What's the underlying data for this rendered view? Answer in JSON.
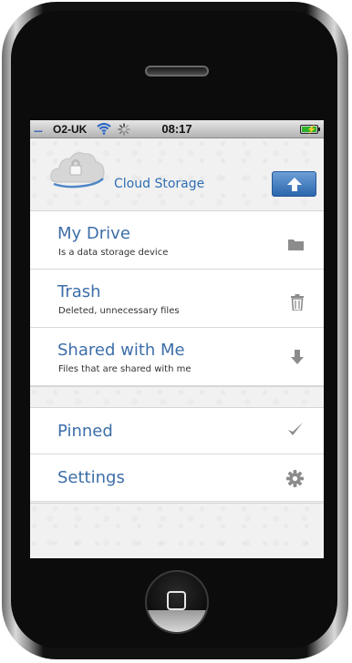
{
  "status_bar": {
    "carrier": "O2-UK",
    "time": "08:17",
    "signal_icon": "signal-bars-icon",
    "wifi_icon": "wifi-icon",
    "activity_icon": "activity-spinner-icon",
    "battery_icon": "battery-charging-icon"
  },
  "header": {
    "app_title": "Cloud Storage",
    "logo_icon": "cloud-lock-icon",
    "upload_icon": "upload-arrow-icon"
  },
  "main_menu": [
    {
      "title": "My Drive",
      "subtitle": "Is a data storage device",
      "icon": "folder-icon"
    },
    {
      "title": "Trash",
      "subtitle": "Deleted, unnecessary files",
      "icon": "trash-icon"
    },
    {
      "title": "Shared with Me",
      "subtitle": "Files that are shared with me",
      "icon": "download-arrow-icon"
    }
  ],
  "secondary_menu": [
    {
      "title": "Pinned",
      "icon": "checkmark-icon"
    },
    {
      "title": "Settings",
      "icon": "gear-icon"
    }
  ],
  "colors": {
    "accent": "#3d6ea8",
    "title_blue": "#2f6fb5",
    "button_top": "#6d9fd6",
    "button_bottom": "#2b66ad",
    "icon_gray": "#8c8c8c"
  }
}
